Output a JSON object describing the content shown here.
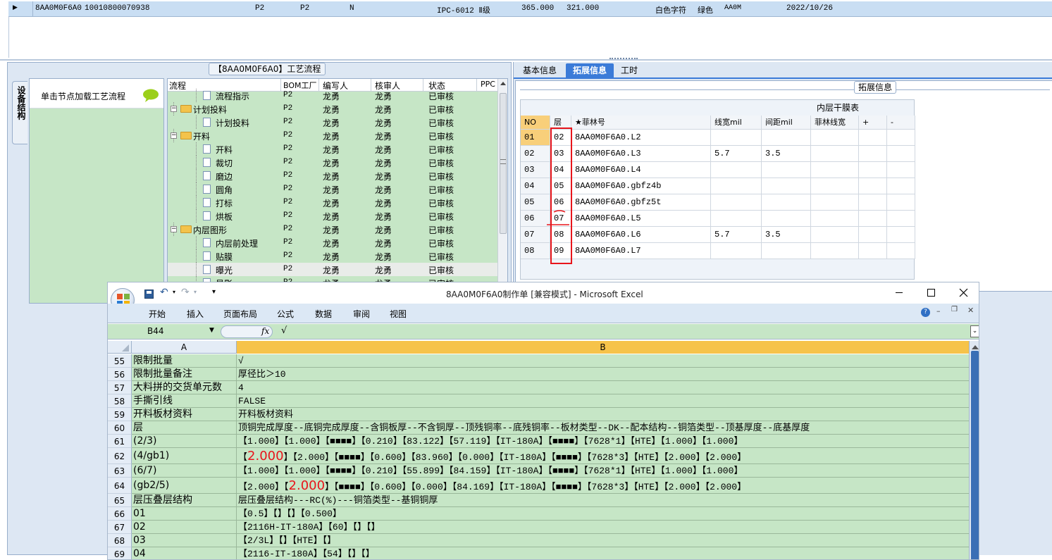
{
  "top_row": {
    "marker": "▶",
    "cells": [
      "8AA0M0F6A0",
      "10010800070938",
      "P2",
      "P2",
      "N",
      "IPC-6012 Ⅱ级",
      "365.000",
      "321.000",
      "白色字符",
      "绿色",
      "AA0M",
      "2022/10/26"
    ]
  },
  "left_panel": {
    "side_tab": "设备结构",
    "hint": "单击节点加载工艺流程",
    "flow_title": "【8AA0M0F6A0】工艺流程",
    "columns": [
      "流程",
      "BOM工厂",
      "编写人",
      "核审人",
      "状态",
      "PPC"
    ],
    "rows": [
      {
        "name": "流程指示",
        "bom": "P2",
        "writer": "龙勇",
        "reviewer": "龙勇",
        "status": "已审核",
        "level": 2,
        "folder": false
      },
      {
        "name": "计划投料",
        "bom": "P2",
        "writer": "龙勇",
        "reviewer": "龙勇",
        "status": "已审核",
        "level": 1,
        "folder": true
      },
      {
        "name": "计划投料",
        "bom": "P2",
        "writer": "龙勇",
        "reviewer": "龙勇",
        "status": "已审核",
        "level": 2,
        "folder": false
      },
      {
        "name": "开料",
        "bom": "P2",
        "writer": "龙勇",
        "reviewer": "龙勇",
        "status": "已审核",
        "level": 1,
        "folder": true
      },
      {
        "name": "开料",
        "bom": "P2",
        "writer": "龙勇",
        "reviewer": "龙勇",
        "status": "已审核",
        "level": 2,
        "folder": false
      },
      {
        "name": "裁切",
        "bom": "P2",
        "writer": "龙勇",
        "reviewer": "龙勇",
        "status": "已审核",
        "level": 2,
        "folder": false
      },
      {
        "name": "磨边",
        "bom": "P2",
        "writer": "龙勇",
        "reviewer": "龙勇",
        "status": "已审核",
        "level": 2,
        "folder": false
      },
      {
        "name": "圆角",
        "bom": "P2",
        "writer": "龙勇",
        "reviewer": "龙勇",
        "status": "已审核",
        "level": 2,
        "folder": false
      },
      {
        "name": "打标",
        "bom": "P2",
        "writer": "龙勇",
        "reviewer": "龙勇",
        "status": "已审核",
        "level": 2,
        "folder": false
      },
      {
        "name": "烘板",
        "bom": "P2",
        "writer": "龙勇",
        "reviewer": "龙勇",
        "status": "已审核",
        "level": 2,
        "folder": false
      },
      {
        "name": "内层图形",
        "bom": "P2",
        "writer": "龙勇",
        "reviewer": "龙勇",
        "status": "已审核",
        "level": 1,
        "folder": true
      },
      {
        "name": "内层前处理",
        "bom": "P2",
        "writer": "龙勇",
        "reviewer": "龙勇",
        "status": "已审核",
        "level": 2,
        "folder": false
      },
      {
        "name": "贴膜",
        "bom": "P2",
        "writer": "龙勇",
        "reviewer": "龙勇",
        "status": "已审核",
        "level": 2,
        "folder": false
      },
      {
        "name": "曝光",
        "bom": "P2",
        "writer": "龙勇",
        "reviewer": "龙勇",
        "status": "已审核",
        "level": 2,
        "folder": false,
        "selected": true
      },
      {
        "name": "显影",
        "bom": "P2",
        "writer": "龙勇",
        "reviewer": "龙勇",
        "status": "已审核",
        "level": 2,
        "folder": false
      }
    ]
  },
  "right_panel": {
    "tabs": [
      "基本信息",
      "拓展信息",
      "工时"
    ],
    "active_tab": 1,
    "group_title": "拓展信息",
    "table_title": "内层干膜表",
    "columns": [
      "NO",
      "层",
      "★菲林号",
      "线宽mil",
      "间距mil",
      "菲林线宽",
      "+",
      "-"
    ],
    "rows": [
      {
        "no": "01",
        "layer": "02",
        "film": "8AA0M0F6A0.L2",
        "width": "",
        "spacing": ""
      },
      {
        "no": "02",
        "layer": "03",
        "film": "8AA0M0F6A0.L3",
        "width": "5.7",
        "spacing": "3.5"
      },
      {
        "no": "03",
        "layer": "04",
        "film": "8AA0M0F6A0.L4",
        "width": "",
        "spacing": ""
      },
      {
        "no": "04",
        "layer": "05",
        "film": "8AA0M0F6A0.gbfz4b",
        "width": "",
        "spacing": ""
      },
      {
        "no": "05",
        "layer": "06",
        "film": "8AA0M0F6A0.gbfz5t",
        "width": "",
        "spacing": ""
      },
      {
        "no": "06",
        "layer": "07",
        "film": "8AA0M0F6A0.L5",
        "width": "",
        "spacing": ""
      },
      {
        "no": "07",
        "layer": "08",
        "film": "8AA0M0F6A0.L6",
        "width": "5.7",
        "spacing": "3.5"
      },
      {
        "no": "08",
        "layer": "09",
        "film": "8AA0M0F6A0.L7",
        "width": "",
        "spacing": ""
      }
    ]
  },
  "excel": {
    "title": "8AA0M0F6A0制作单 [兼容模式] - Microsoft Excel",
    "ribbon_tabs": [
      "开始",
      "插入",
      "页面布局",
      "公式",
      "数据",
      "审阅",
      "视图"
    ],
    "name_box": "B44",
    "formula": "√",
    "col_a": "A",
    "col_b": "B",
    "rows": [
      {
        "n": "55",
        "a": "限制批量",
        "b": "√"
      },
      {
        "n": "56",
        "a": "限制批量备注",
        "b": "厚径比＞10"
      },
      {
        "n": "57",
        "a": "大料拼的交货单元数",
        "b": "4"
      },
      {
        "n": "58",
        "a": "手撕引线",
        "b": "FALSE"
      },
      {
        "n": "59",
        "a": "开料板材资料",
        "b": "开料板材资料"
      },
      {
        "n": "60",
        "a": "层",
        "b": "顶铜完成厚度--底铜完成厚度--含铜板厚--不含铜厚--顶残铜率--底残铜率--板材类型--DK--配本结构--铜箔类型--顶基厚度--底基厚度"
      },
      {
        "n": "61",
        "a": "(2/3)",
        "b": "【1.000】【1.000】【■■■■】【0.210】【83.122】【57.119】【IT-180A】【■■■■】【7628*1】【HTE】【1.000】【1.000】"
      },
      {
        "n": "62",
        "a": "(4/gb1)",
        "b_pre": "【",
        "b_red": "2.000",
        "b_post": "】【2.000】【■■■■】【0.600】【83.960】【0.000】【IT-180A】【■■■■】【7628*3】【HTE】【2.000】【2.000】"
      },
      {
        "n": "63",
        "a": "(6/7)",
        "b": "【1.000】【1.000】【■■■■】【0.210】【55.899】【84.159】【IT-180A】【■■■■】【7628*1】【HTE】【1.000】【1.000】"
      },
      {
        "n": "64",
        "a": "(gb2/5)",
        "b_pre": "【2.000】【",
        "b_red": "2.000",
        "b_post": "】【■■■■】【0.600】【0.000】【84.169】【IT-180A】【■■■■】【7628*3】【HTE】【2.000】【2.000】"
      },
      {
        "n": "65",
        "a": "层压叠层结构",
        "b": "层压叠层结构---RC(%)---铜箔类型--基铜铜厚"
      },
      {
        "n": "66",
        "a": "01",
        "b": "【0.5】【】【】【0.500】"
      },
      {
        "n": "67",
        "a": "02",
        "b": "【2116H-IT-180A】【60】【】【】"
      },
      {
        "n": "68",
        "a": "03",
        "b": "【2/3L】【】【HTE】【】"
      },
      {
        "n": "69",
        "a": "04",
        "b": "【2116-IT-180A】【54】【】【】"
      }
    ]
  },
  "colors": {
    "green": "#c6e6c6",
    "blue_selection": "#cfe3f7",
    "excel_header": "#f6c34a",
    "tab_active": "#3b7bd8",
    "annotation_red": "#e8151b"
  }
}
